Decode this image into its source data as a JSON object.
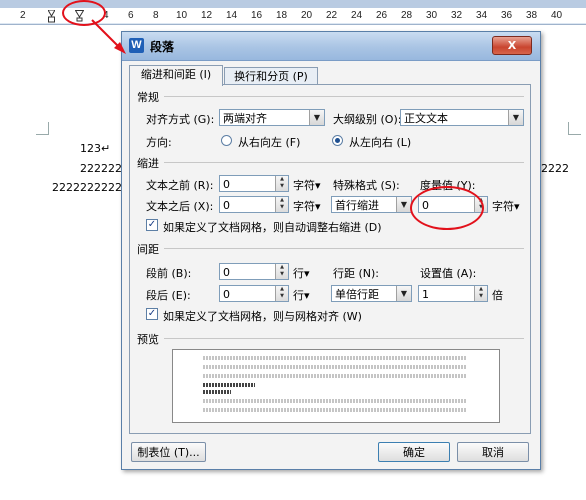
{
  "ruler": {
    "numbers": [
      "2",
      "2",
      "4",
      "6",
      "8",
      "10",
      "12",
      "14",
      "16",
      "18",
      "20",
      "22",
      "24",
      "26",
      "28",
      "30",
      "32",
      "34",
      "36",
      "38",
      "40"
    ]
  },
  "document": {
    "line1": "123↵",
    "line2_left": "2222222",
    "line3_left": "22222222222",
    "line2_right": "2222"
  },
  "dialog": {
    "title": "段落",
    "app_icon": "W",
    "close_label": "X",
    "tabs": [
      "缩进和间距 (I)",
      "换行和分页 (P)"
    ],
    "general": {
      "heading": "常规",
      "align_label": "对齐方式 (G):",
      "align_value": "两端对齐",
      "outline_label": "大纲级别 (O):",
      "outline_value": "正文文本",
      "direction_label": "方向:",
      "rtl_label": "从右向左 (F)",
      "ltr_label": "从左向右 (L)",
      "direction_selected": "ltr"
    },
    "indent": {
      "heading": "缩进",
      "before_label": "文本之前 (R):",
      "before_value": "0",
      "before_unit": "字符▾",
      "after_label": "文本之后 (X):",
      "after_value": "0",
      "after_unit": "字符▾",
      "special_label": "特殊格式 (S):",
      "special_value": "首行缩进",
      "measure_label": "度量值 (Y):",
      "measure_value": "0",
      "measure_unit": "字符▾",
      "grid_check_label": "如果定义了文档网格，则自动调整右缩进 (D)",
      "grid_checked": true
    },
    "spacing": {
      "heading": "间距",
      "before_label": "段前 (B):",
      "before_value": "0",
      "before_unit": "行▾",
      "after_label": "段后 (E):",
      "after_value": "0",
      "after_unit": "行▾",
      "line_label": "行距 (N):",
      "line_value": "单倍行距",
      "setting_label": "设置值 (A):",
      "setting_value": "1",
      "setting_unit": "倍",
      "grid_check_label": "如果定义了文档网格，则与网格对齐 (W)",
      "grid_checked": true
    },
    "preview": {
      "heading": "预览"
    },
    "buttons": {
      "tabs_label": "制表位 (T)...",
      "ok_label": "确定",
      "cancel_label": "取消"
    }
  },
  "colors": {
    "annotation": "#e2111b",
    "title_bar": "#a9c4e4"
  }
}
